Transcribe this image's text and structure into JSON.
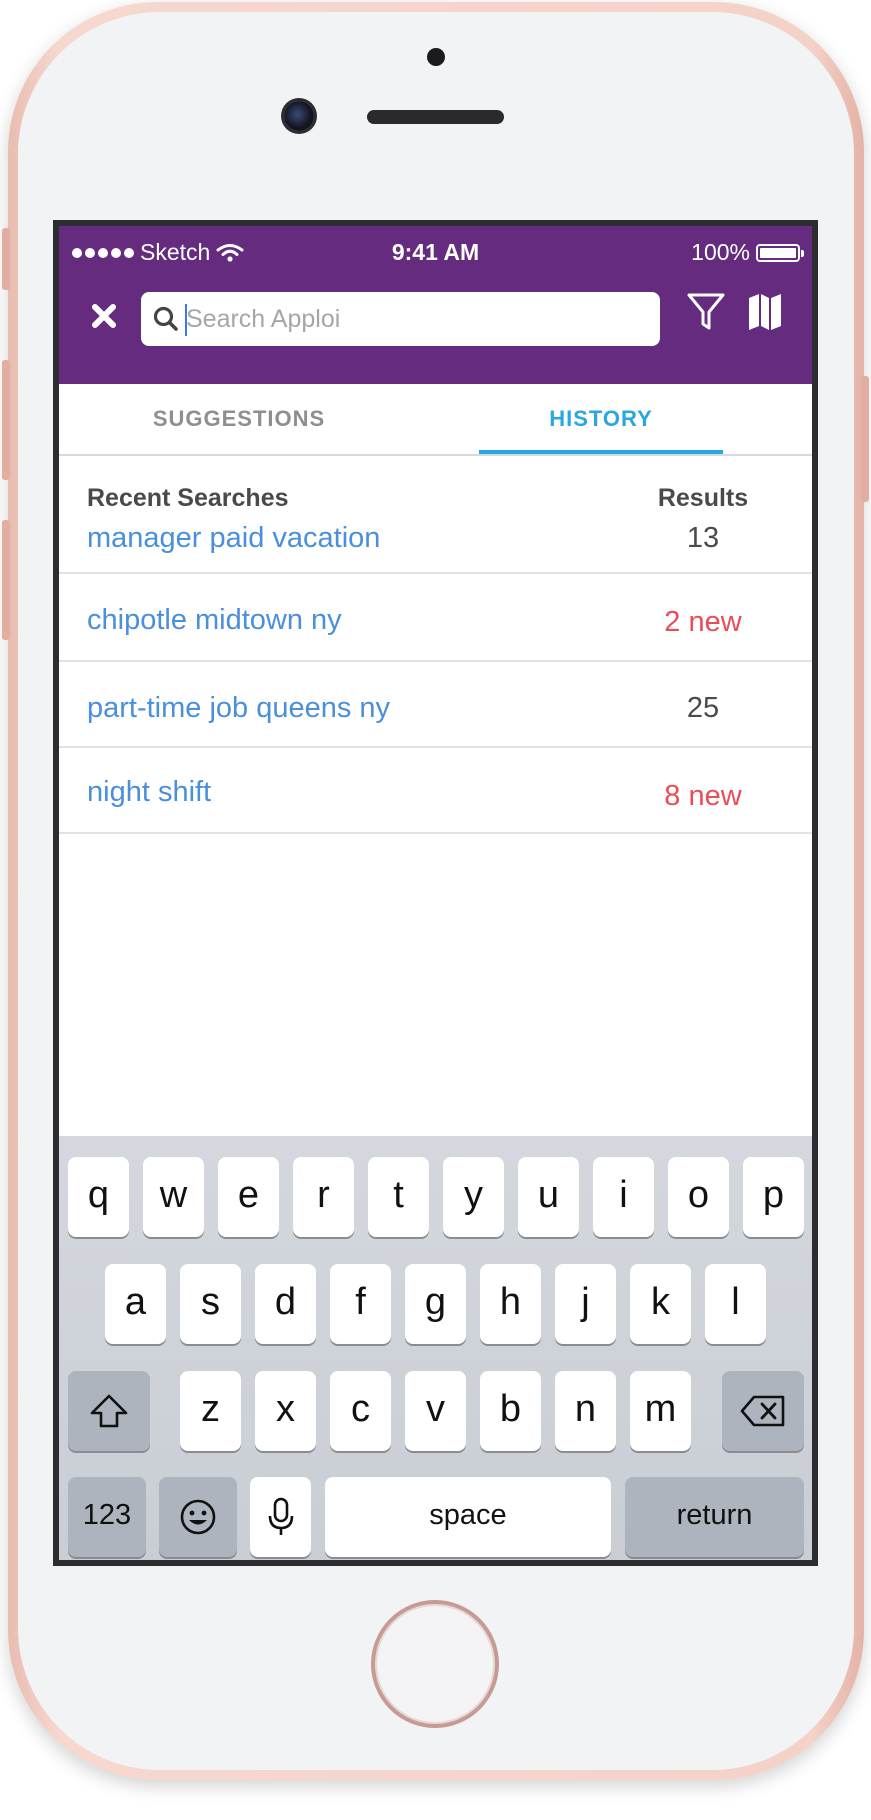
{
  "status_bar": {
    "carrier": "Sketch",
    "time": "9:41 AM",
    "battery": "100%"
  },
  "header": {
    "close_icon": "close-icon",
    "search_placeholder": "Search Apploi",
    "search_value": "",
    "filter_icon": "filter-icon",
    "map_icon": "map-icon",
    "bar_color": "#642b7e"
  },
  "tabs": [
    {
      "label": "SUGGESTIONS",
      "active": false
    },
    {
      "label": "HISTORY",
      "active": true
    }
  ],
  "history": {
    "col_query": "Recent Searches",
    "col_results": "Results",
    "rows": [
      {
        "query": "manager paid vacation",
        "result": "13",
        "is_new": false
      },
      {
        "query": "chipotle midtown ny",
        "result": "2 new",
        "is_new": true
      },
      {
        "query": "part-time job queens ny",
        "result": "25",
        "is_new": false
      },
      {
        "query": "night shift",
        "result": "8 new",
        "is_new": true
      }
    ]
  },
  "keyboard": {
    "row1": [
      "q",
      "w",
      "e",
      "r",
      "t",
      "y",
      "u",
      "i",
      "o",
      "p"
    ],
    "row2": [
      "a",
      "s",
      "d",
      "f",
      "g",
      "h",
      "j",
      "k",
      "l"
    ],
    "row3": [
      "z",
      "x",
      "c",
      "v",
      "b",
      "n",
      "m"
    ],
    "numbers_key": "123",
    "space_key": "space",
    "return_key": "return"
  }
}
